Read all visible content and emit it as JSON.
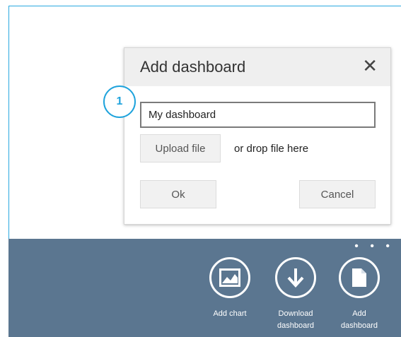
{
  "dialog": {
    "title": "Add dashboard",
    "close_glyph": "✕",
    "name_value": "My dashboard",
    "upload_label": "Upload file",
    "drop_text": "or drop file here",
    "ok_label": "Ok",
    "cancel_label": "Cancel"
  },
  "callout": {
    "number": "1"
  },
  "appbar": {
    "more_glyph": "• • •",
    "buttons": [
      {
        "label": "Add chart",
        "icon": "chart-image-icon"
      },
      {
        "label": "Download dashboard",
        "icon": "download-arrow-icon"
      },
      {
        "label": "Add dashboard",
        "icon": "document-icon"
      }
    ]
  },
  "colors": {
    "accent": "#1fa3dc",
    "appbar_bg": "#5b7690",
    "dialog_header_bg": "#efefef"
  }
}
